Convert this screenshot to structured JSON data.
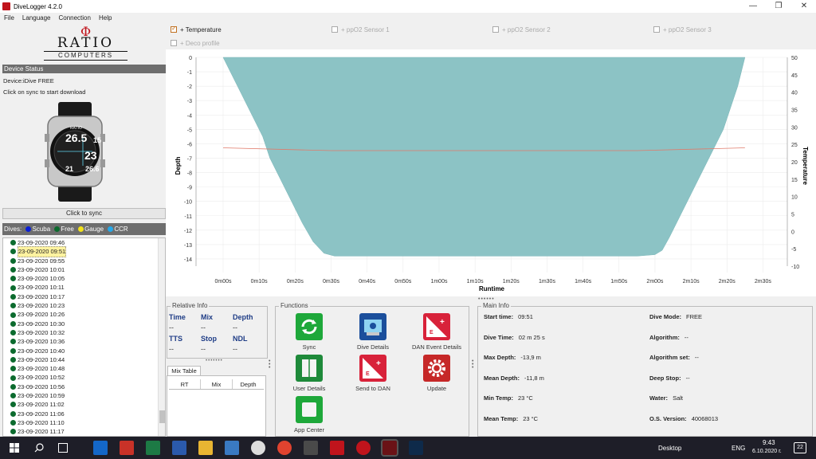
{
  "window": {
    "title": "DiveLogger 4.2.0",
    "min": "—",
    "max": "❐",
    "close": "✕"
  },
  "menu": [
    "File",
    "Language",
    "Connection",
    "Help"
  ],
  "logo": {
    "mark": "Φ",
    "name": "RATIO",
    "sub": "COMPUTERS"
  },
  "device": {
    "section": "Device Status",
    "name": "Device:iDive FREE",
    "hint": "Click on sync to start download",
    "sync_button": "Click to sync",
    "watch": {
      "brand": "RATIO",
      "depth": "26.5",
      "right1": "15",
      "mid": "23",
      "left2": "21",
      "right2": "26.6",
      "model": "iDive"
    }
  },
  "dives_legend": {
    "label": "Dives:",
    "items": [
      {
        "name": "Scuba",
        "color": "#0a1fd6"
      },
      {
        "name": "Free",
        "color": "#0c6b2e"
      },
      {
        "name": "Gauge",
        "color": "#f2e21a"
      },
      {
        "name": "CCR",
        "color": "#26a8e8"
      }
    ]
  },
  "dives": [
    "23-09-2020 09:46",
    "23-09-2020 09:51",
    "23-09-2020 09:55",
    "23-09-2020 10:01",
    "23-09-2020 10:05",
    "23-09-2020 10:11",
    "23-09-2020 10:17",
    "23-09-2020 10:23",
    "23-09-2020 10:26",
    "23-09-2020 10:30",
    "23-09-2020 10:32",
    "23-09-2020 10:36",
    "23-09-2020 10:40",
    "23-09-2020 10:44",
    "23-09-2020 10:48",
    "23-09-2020 10:52",
    "23-09-2020 10:56",
    "23-09-2020 10:59",
    "23-09-2020 11:02",
    "23-09-2020 11:06",
    "23-09-2020 11:10",
    "23-09-2020 11:17"
  ],
  "selected_dive": 1,
  "checkboxes": {
    "temperature": "+ Temperature",
    "ppo2_1": "+ ppO2 Sensor 1",
    "ppo2_2": "+ ppO2 Sensor 2",
    "ppo2_3": "+ ppO2 Sensor 3",
    "deco": "+ Deco profile"
  },
  "chart_data": {
    "type": "area",
    "xlabel": "Runtime",
    "ylabel": "Depth",
    "y2label": "Temperature",
    "x_ticks": [
      "0m00s",
      "0m10s",
      "0m20s",
      "0m30s",
      "0m40s",
      "0m50s",
      "1m00s",
      "1m10s",
      "1m20s",
      "1m30s",
      "1m40s",
      "1m50s",
      "2m00s",
      "2m10s",
      "2m20s",
      "2m30s"
    ],
    "y_ticks": [
      "0",
      "-1",
      "-2",
      "-3",
      "-4",
      "-5",
      "-6",
      "-7",
      "-8",
      "-9",
      "-10",
      "-11",
      "-12",
      "-13",
      "-14"
    ],
    "y2_ticks": [
      "50",
      "45",
      "40",
      "35",
      "30",
      "25",
      "20",
      "15",
      "10",
      "5",
      "0",
      "-5",
      "-10"
    ],
    "ylim": [
      -14.5,
      0
    ],
    "y2lim": [
      -10,
      50
    ],
    "xlim": [
      0,
      155
    ],
    "depth_series": {
      "name": "Depth",
      "color": "#8cc3c5",
      "points": [
        [
          0,
          0
        ],
        [
          2,
          -1
        ],
        [
          5,
          -2.5
        ],
        [
          8,
          -4
        ],
        [
          11,
          -5.5
        ],
        [
          13,
          -7
        ],
        [
          16,
          -8.5
        ],
        [
          19,
          -10
        ],
        [
          22,
          -11.5
        ],
        [
          25,
          -12.8
        ],
        [
          28,
          -13.6
        ],
        [
          31,
          -13.8
        ],
        [
          40,
          -13.8
        ],
        [
          60,
          -13.8
        ],
        [
          80,
          -13.8
        ],
        [
          100,
          -13.8
        ],
        [
          115,
          -13.8
        ],
        [
          120,
          -13.7
        ],
        [
          122,
          -13.4
        ],
        [
          124,
          -12.5
        ],
        [
          127,
          -11
        ],
        [
          130,
          -9.5
        ],
        [
          133,
          -8
        ],
        [
          136,
          -6.5
        ],
        [
          139,
          -5
        ],
        [
          141,
          -3.5
        ],
        [
          143,
          -2
        ],
        [
          145,
          0
        ]
      ]
    },
    "temp_series": {
      "name": "Temperature",
      "color": "#e07a6a",
      "points": [
        [
          0,
          24
        ],
        [
          30,
          23.2
        ],
        [
          115,
          23.2
        ],
        [
          145,
          24
        ]
      ]
    }
  },
  "relative_info": {
    "label": "Relative Info",
    "fields": [
      {
        "name": "Time",
        "value": "--"
      },
      {
        "name": "Mix",
        "value": "--"
      },
      {
        "name": "Depth",
        "value": "--"
      },
      {
        "name": "TTS",
        "value": "--"
      },
      {
        "name": "Stop",
        "value": "--"
      },
      {
        "name": "NDL",
        "value": "--"
      }
    ]
  },
  "mix_table": {
    "tab": "Mix Table",
    "columns": [
      "RT",
      "Mix",
      "Depth"
    ]
  },
  "functions": {
    "label": "Functions",
    "items": [
      "Sync",
      "Dive Details",
      "DAN Event Details",
      "User Details",
      "Send to DAN",
      "Update",
      "App Center"
    ]
  },
  "main_info": {
    "label": "Main Info",
    "left": [
      {
        "k": "Start time:",
        "v": "09:51"
      },
      {
        "k": "Dive Time:",
        "v": "02 m 25 s"
      },
      {
        "k": "Max Depth:",
        "v": "-13,9 m"
      },
      {
        "k": "Mean Depth:",
        "v": "-11,8 m"
      },
      {
        "k": "Min Temp:",
        "v": "23 °C"
      },
      {
        "k": "Mean Temp:",
        "v": "23 °C"
      }
    ],
    "right": [
      {
        "k": "Dive Mode:",
        "v": "FREE"
      },
      {
        "k": "Algorithm:",
        "v": "--"
      },
      {
        "k": "Algorithm set:",
        "v": "--"
      },
      {
        "k": "Deep Stop:",
        "v": "--"
      },
      {
        "k": "Water:",
        "v": "Salt"
      },
      {
        "k": "O.S. Version:",
        "v": "40068013"
      }
    ]
  },
  "taskbar": {
    "desktop": "Desktop",
    "lang": "ENG",
    "time": "9:43",
    "date": "6.10.2020 г.",
    "badge": "22"
  }
}
